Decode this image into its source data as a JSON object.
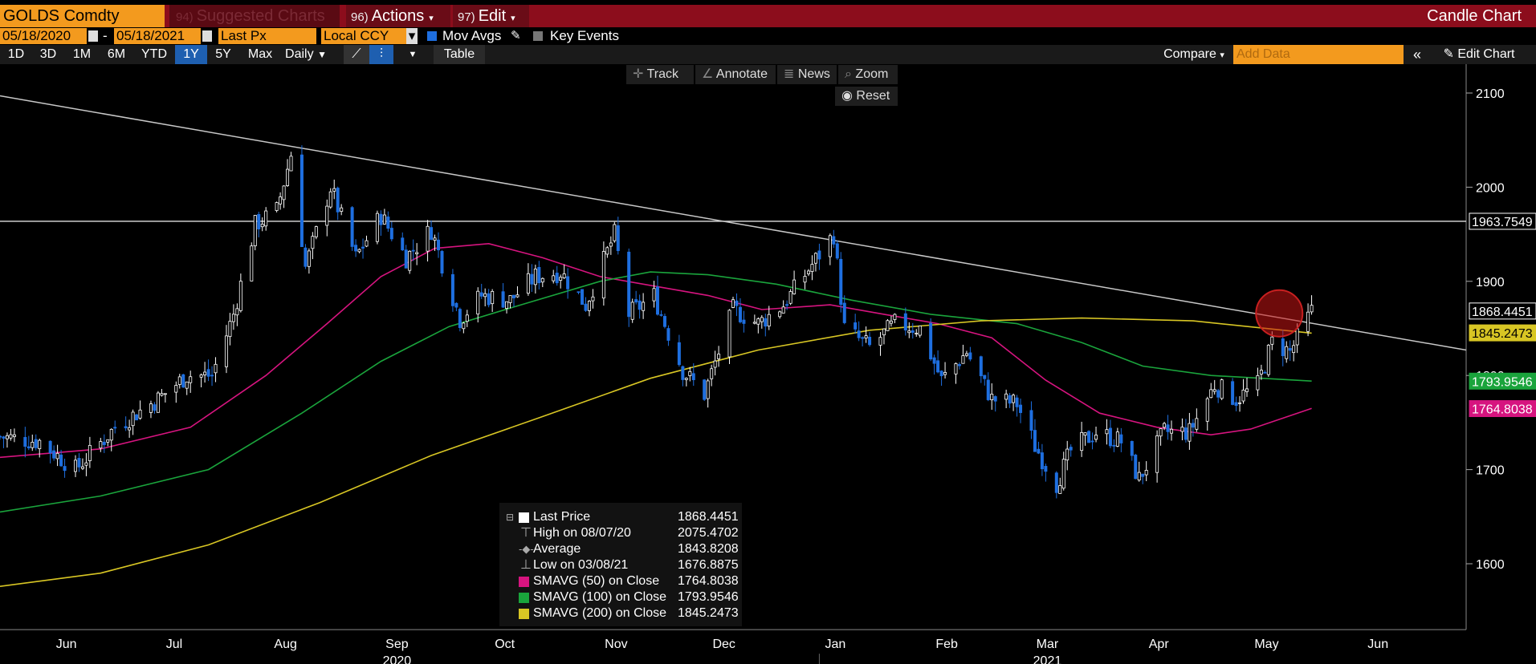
{
  "header": {
    "ticker": "GOLDS Comdty",
    "suggested_num": "94)",
    "suggested_label": "Suggested Charts",
    "actions_num": "96)",
    "actions_label": "Actions",
    "edit_num": "97)",
    "edit_label": "Edit",
    "chart_type": "Candle Chart"
  },
  "controls": {
    "start_date": "05/18/2020",
    "date_sep": "-",
    "end_date": "05/18/2021",
    "price_field": "Last Px",
    "currency": "Local CCY",
    "mov_avgs_label": "Mov Avgs",
    "key_events_label": "Key Events"
  },
  "range_bar": {
    "buttons": [
      "1D",
      "3D",
      "1M",
      "6M",
      "YTD",
      "1Y",
      "5Y",
      "Max"
    ],
    "selected": "1Y",
    "interval": "Daily",
    "table_label": "Table",
    "compare_label": "Compare",
    "add_data_placeholder": "Add Data",
    "edit_chart_label": "Edit Chart"
  },
  "toolbar": {
    "track": "Track",
    "annotate": "Annotate",
    "news": "News",
    "zoom": "Zoom",
    "reset": "Reset"
  },
  "colors": {
    "price_up": "#ffffff",
    "price_down": "#1e6fe0",
    "sma50": "#d6147f",
    "sma100": "#1aa43c",
    "sma200": "#d8c624",
    "trendline": "#c8c8c8",
    "accent_orange": "#f39a1e",
    "header_red": "#8c0d1c"
  },
  "legend": [
    {
      "label": "Last Price",
      "value": "1868.4451",
      "swatch": "#ffffff"
    },
    {
      "label": "High on 08/07/20",
      "value": "2075.4702",
      "swatch": ""
    },
    {
      "label": "Average",
      "value": "1843.8208",
      "swatch": ""
    },
    {
      "label": "Low on 03/08/21",
      "value": "1676.8875",
      "swatch": ""
    },
    {
      "label": "SMAVG (50)  on Close",
      "value": "1764.8038",
      "swatch": "#d6147f"
    },
    {
      "label": "SMAVG (100)  on Close",
      "value": "1793.9546",
      "swatch": "#1aa43c"
    },
    {
      "label": "SMAVG (200)  on Close",
      "value": "1845.2473",
      "swatch": "#d8c624"
    }
  ],
  "chart_data": {
    "type": "line",
    "title": "",
    "xlabel": "",
    "ylabel": "",
    "x_range": [
      "2020-05-18",
      "2021-06-30"
    ],
    "ylim": [
      1530,
      2130
    ],
    "y_ticks": [
      1600,
      1700,
      1800,
      1900,
      2000,
      2100
    ],
    "x_tick_labels": [
      "Jun",
      "Jul",
      "Aug",
      "Sep",
      "Oct",
      "Nov",
      "Dec",
      "Jan",
      "Feb",
      "Mar",
      "Apr",
      "May",
      "Jun"
    ],
    "x_tick_dates": [
      "2020-06-01",
      "2020-07-01",
      "2020-08-01",
      "2020-09-01",
      "2020-10-01",
      "2020-11-01",
      "2020-12-01",
      "2021-01-01",
      "2021-02-01",
      "2021-03-01",
      "2021-04-01",
      "2021-05-01",
      "2021-06-01"
    ],
    "year_labels": [
      {
        "label": "2020",
        "date": "2020-09-01"
      },
      {
        "label": "2021",
        "date": "2021-03-01"
      }
    ],
    "price_labels": [
      {
        "value": 1963.7549,
        "text": "1963.7549",
        "bg": "#000000",
        "fg": "#ffffff"
      },
      {
        "value": 1868.4451,
        "text": "1868.4451",
        "bg": "#000000",
        "fg": "#ffffff"
      },
      {
        "value": 1845.2473,
        "text": "1845.2473",
        "bg": "#d8c624",
        "fg": "#000000"
      },
      {
        "value": 1793.9546,
        "text": "1793.9546",
        "bg": "#1aa43c",
        "fg": "#ffffff"
      },
      {
        "value": 1764.8038,
        "text": "1764.8038",
        "bg": "#d6147f",
        "fg": "#ffffff"
      }
    ],
    "horizontal_line": 1963.7549,
    "trendline": [
      {
        "date": "2020-05-18",
        "value": 2097
      },
      {
        "date": "2021-06-30",
        "value": 1827
      }
    ],
    "highlight_circle": {
      "date": "2021-05-09",
      "value": 1866
    },
    "price_series": [
      {
        "date": "2020-05-18",
        "value": 1735
      },
      {
        "date": "2020-05-29",
        "value": 1730
      },
      {
        "date": "2020-06-08",
        "value": 1700
      },
      {
        "date": "2020-06-19",
        "value": 1745
      },
      {
        "date": "2020-07-01",
        "value": 1775
      },
      {
        "date": "2020-07-09",
        "value": 1800
      },
      {
        "date": "2020-07-16",
        "value": 1800
      },
      {
        "date": "2020-07-22",
        "value": 1865
      },
      {
        "date": "2020-07-28",
        "value": 1960
      },
      {
        "date": "2020-08-03",
        "value": 1975
      },
      {
        "date": "2020-08-07",
        "value": 2035
      },
      {
        "date": "2020-08-11",
        "value": 1915
      },
      {
        "date": "2020-08-18",
        "value": 2000
      },
      {
        "date": "2020-08-25",
        "value": 1925
      },
      {
        "date": "2020-09-01",
        "value": 1970
      },
      {
        "date": "2020-09-08",
        "value": 1925
      },
      {
        "date": "2020-09-15",
        "value": 1955
      },
      {
        "date": "2020-09-23",
        "value": 1860
      },
      {
        "date": "2020-09-29",
        "value": 1885
      },
      {
        "date": "2020-10-07",
        "value": 1880
      },
      {
        "date": "2020-10-14",
        "value": 1905
      },
      {
        "date": "2020-10-21",
        "value": 1910
      },
      {
        "date": "2020-10-28",
        "value": 1875
      },
      {
        "date": "2020-11-05",
        "value": 1950
      },
      {
        "date": "2020-11-09",
        "value": 1865
      },
      {
        "date": "2020-11-16",
        "value": 1885
      },
      {
        "date": "2020-11-24",
        "value": 1805
      },
      {
        "date": "2020-11-30",
        "value": 1780
      },
      {
        "date": "2020-12-08",
        "value": 1870
      },
      {
        "date": "2020-12-15",
        "value": 1855
      },
      {
        "date": "2020-12-22",
        "value": 1875
      },
      {
        "date": "2021-01-05",
        "value": 1950
      },
      {
        "date": "2021-01-08",
        "value": 1850
      },
      {
        "date": "2021-01-15",
        "value": 1830
      },
      {
        "date": "2021-01-22",
        "value": 1855
      },
      {
        "date": "2021-01-29",
        "value": 1850
      },
      {
        "date": "2021-02-04",
        "value": 1795
      },
      {
        "date": "2021-02-11",
        "value": 1825
      },
      {
        "date": "2021-02-18",
        "value": 1775
      },
      {
        "date": "2021-02-25",
        "value": 1770
      },
      {
        "date": "2021-03-02",
        "value": 1725
      },
      {
        "date": "2021-03-08",
        "value": 1685
      },
      {
        "date": "2021-03-12",
        "value": 1720
      },
      {
        "date": "2021-03-19",
        "value": 1740
      },
      {
        "date": "2021-03-26",
        "value": 1730
      },
      {
        "date": "2021-03-31",
        "value": 1690
      },
      {
        "date": "2021-04-07",
        "value": 1740
      },
      {
        "date": "2021-04-14",
        "value": 1740
      },
      {
        "date": "2021-04-21",
        "value": 1790
      },
      {
        "date": "2021-04-27",
        "value": 1775
      },
      {
        "date": "2021-05-03",
        "value": 1790
      },
      {
        "date": "2021-05-07",
        "value": 1835
      },
      {
        "date": "2021-05-12",
        "value": 1825
      },
      {
        "date": "2021-05-18",
        "value": 1868
      }
    ],
    "series": [
      {
        "name": "SMAVG (50)",
        "color": "#d6147f",
        "values": [
          {
            "date": "2020-05-18",
            "value": 1713
          },
          {
            "date": "2020-06-15",
            "value": 1722
          },
          {
            "date": "2020-07-10",
            "value": 1745
          },
          {
            "date": "2020-07-31",
            "value": 1800
          },
          {
            "date": "2020-08-17",
            "value": 1855
          },
          {
            "date": "2020-09-01",
            "value": 1905
          },
          {
            "date": "2020-09-16",
            "value": 1935
          },
          {
            "date": "2020-10-01",
            "value": 1940
          },
          {
            "date": "2020-10-16",
            "value": 1925
          },
          {
            "date": "2020-11-01",
            "value": 1905
          },
          {
            "date": "2020-11-16",
            "value": 1895
          },
          {
            "date": "2020-12-01",
            "value": 1885
          },
          {
            "date": "2020-12-16",
            "value": 1870
          },
          {
            "date": "2021-01-04",
            "value": 1875
          },
          {
            "date": "2021-01-19",
            "value": 1865
          },
          {
            "date": "2021-02-03",
            "value": 1855
          },
          {
            "date": "2021-02-18",
            "value": 1840
          },
          {
            "date": "2021-03-05",
            "value": 1795
          },
          {
            "date": "2021-03-20",
            "value": 1760
          },
          {
            "date": "2021-04-05",
            "value": 1745
          },
          {
            "date": "2021-04-20",
            "value": 1737
          },
          {
            "date": "2021-05-01",
            "value": 1743
          },
          {
            "date": "2021-05-18",
            "value": 1765
          }
        ]
      },
      {
        "name": "SMAVG (100)",
        "color": "#1aa43c",
        "values": [
          {
            "date": "2020-05-18",
            "value": 1655
          },
          {
            "date": "2020-06-15",
            "value": 1672
          },
          {
            "date": "2020-07-15",
            "value": 1700
          },
          {
            "date": "2020-08-10",
            "value": 1760
          },
          {
            "date": "2020-09-01",
            "value": 1815
          },
          {
            "date": "2020-09-20",
            "value": 1852
          },
          {
            "date": "2020-10-10",
            "value": 1875
          },
          {
            "date": "2020-11-01",
            "value": 1900
          },
          {
            "date": "2020-11-15",
            "value": 1910
          },
          {
            "date": "2020-12-01",
            "value": 1907
          },
          {
            "date": "2020-12-20",
            "value": 1897
          },
          {
            "date": "2021-01-10",
            "value": 1880
          },
          {
            "date": "2021-02-01",
            "value": 1865
          },
          {
            "date": "2021-02-25",
            "value": 1855
          },
          {
            "date": "2021-03-15",
            "value": 1835
          },
          {
            "date": "2021-04-01",
            "value": 1810
          },
          {
            "date": "2021-04-20",
            "value": 1800
          },
          {
            "date": "2021-05-18",
            "value": 1794
          }
        ]
      },
      {
        "name": "SMAVG (200)",
        "color": "#d8c624",
        "values": [
          {
            "date": "2020-05-18",
            "value": 1576
          },
          {
            "date": "2020-06-15",
            "value": 1590
          },
          {
            "date": "2020-07-15",
            "value": 1620
          },
          {
            "date": "2020-08-15",
            "value": 1665
          },
          {
            "date": "2020-09-15",
            "value": 1715
          },
          {
            "date": "2020-10-15",
            "value": 1755
          },
          {
            "date": "2020-11-15",
            "value": 1797
          },
          {
            "date": "2020-12-15",
            "value": 1827
          },
          {
            "date": "2021-01-15",
            "value": 1848
          },
          {
            "date": "2021-02-15",
            "value": 1858
          },
          {
            "date": "2021-03-15",
            "value": 1861
          },
          {
            "date": "2021-04-15",
            "value": 1858
          },
          {
            "date": "2021-05-18",
            "value": 1845
          }
        ]
      }
    ]
  }
}
